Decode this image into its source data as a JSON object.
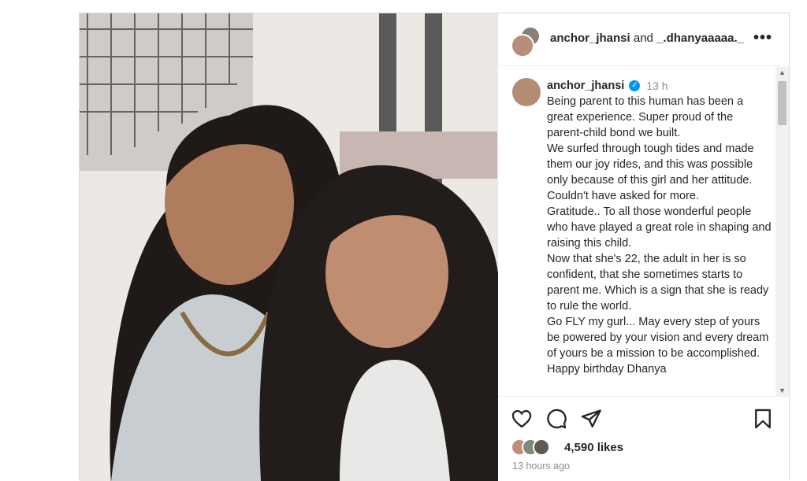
{
  "header": {
    "user1": "anchor_jhansi",
    "connector": " and ",
    "user2": "_.dhanyaaaaa._",
    "more": "•••"
  },
  "caption": {
    "username": "anchor_jhansi",
    "verified": "✓",
    "time": "13 h",
    "text": "Being parent to this human has been a great experience. Super proud of the parent-child bond we built.\nWe surfed through tough tides and made them our joy rides, and this was possible only because of this girl and her attitude. Couldn't have asked for more.\nGratitude.. To all those wonderful people who have played a great role in shaping and raising this child.\nNow that she's 22, the adult in her is so confident, that she sometimes starts to parent me. Which is a sign that she is ready to rule the world.\nGo FLY my gurl... May every step of yours be powered by your vision and every dream of yours be a mission to be accomplished.\nHappy birthday Dhanya"
  },
  "scrollbar": {
    "up": "▲",
    "down": "▼"
  },
  "footer": {
    "likes": "4,590 likes",
    "ago": "13 hours ago"
  },
  "icons": {
    "like": "heart-icon",
    "comment": "comment-icon",
    "share": "share-icon",
    "save": "bookmark-icon"
  },
  "colors": {
    "verified": "#0095f6",
    "muted": "#8e8e8e",
    "text": "#262626"
  }
}
